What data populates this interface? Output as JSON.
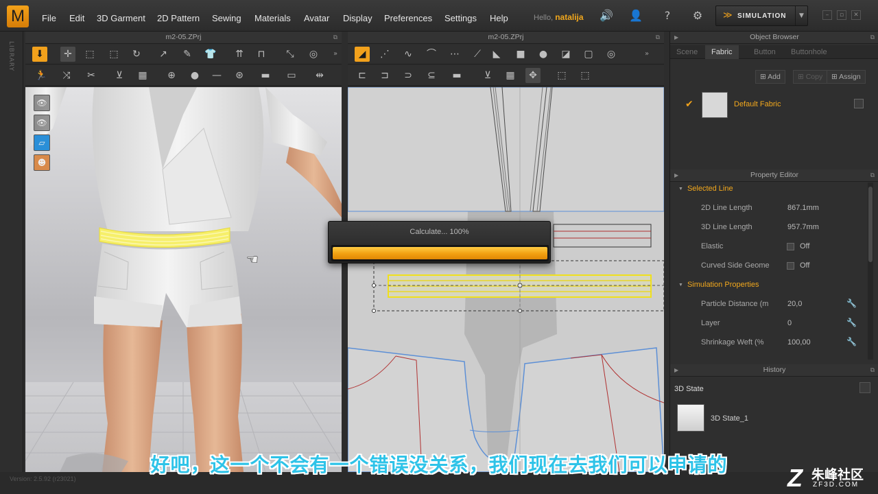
{
  "app": {
    "logo": "M",
    "menu": [
      "File",
      "Edit",
      "3D Garment",
      "2D Pattern",
      "Sewing",
      "Materials",
      "Avatar",
      "Display",
      "Preferences",
      "Settings",
      "Help"
    ],
    "hello_prefix": "Hello,",
    "user": "natalija",
    "simulation_label": "SIMULATION",
    "accent_color": "#f2a11c"
  },
  "left_strip": {
    "label": "LIBRARY"
  },
  "view3d": {
    "title": "m2-05.ZPrj"
  },
  "view2d": {
    "title": "m2-05.ZPrj"
  },
  "progress": {
    "text": "Calculate... 100%",
    "value": 1.0
  },
  "object_browser": {
    "title": "Object Browser",
    "tabs": [
      "Scene",
      "Fabric",
      "Button",
      "Buttonhole"
    ],
    "active_tab": "Fabric",
    "buttons": {
      "add": "Add",
      "copy": "Copy",
      "assign": "Assign"
    },
    "fabric_name": "Default Fabric"
  },
  "property_editor": {
    "title": "Property Editor",
    "selected_line": {
      "label": "Selected Line",
      "rows": [
        {
          "key": "2D Line Length",
          "value": "867.1mm"
        },
        {
          "key": "3D Line Length",
          "value": "957.7mm"
        }
      ],
      "elastic": {
        "key": "Elastic",
        "value": "Off"
      },
      "curved": {
        "key": "Curved Side Geome",
        "value": "Off"
      }
    },
    "simulation": {
      "label": "Simulation Properties",
      "rows": [
        {
          "key": "Particle Distance (m",
          "value": "20,0"
        },
        {
          "key": "Layer",
          "value": "0"
        },
        {
          "key": "Shrinkage Weft (%",
          "value": "100,00"
        }
      ]
    }
  },
  "history": {
    "title": "History",
    "state_label": "3D State",
    "entry": "3D State_1"
  },
  "status": {
    "version": "Version: 2.5.92     (r23021)"
  },
  "subtitle": "好吧，这一个不会有一个错误没关系，我们现在去我们可以申请的",
  "watermark": {
    "brand": "朱峰社区",
    "url": "ZF3D.COM"
  }
}
